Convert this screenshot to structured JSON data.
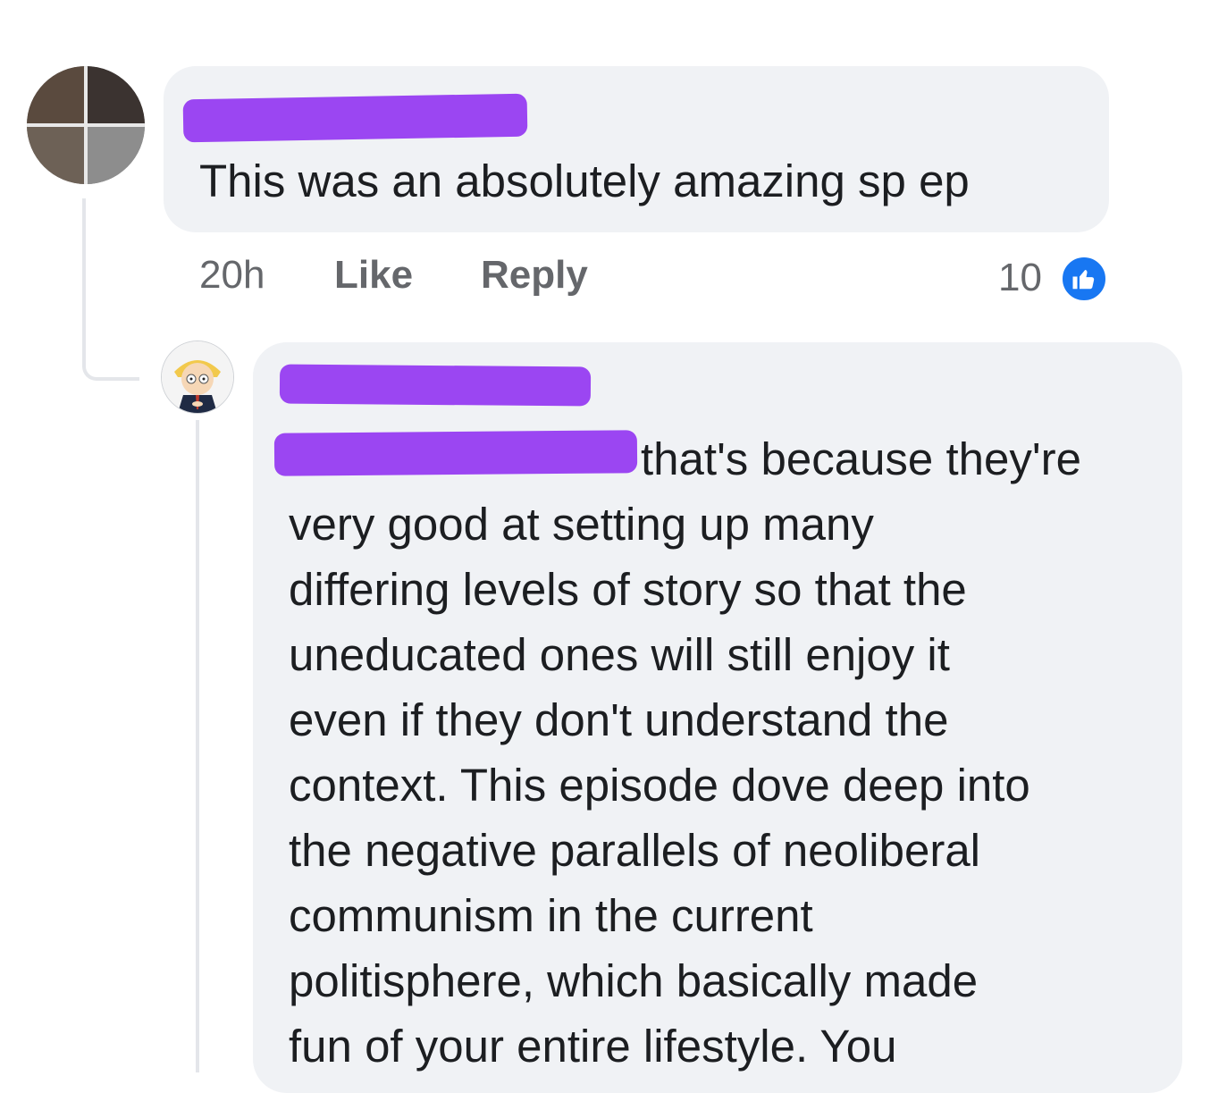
{
  "comment_1": {
    "text": "This was an absolutely amazing sp ep",
    "time": "20h",
    "like_label": "Like",
    "reply_label": "Reply",
    "reaction_count": "10",
    "reaction_icon": "thumbs-up-icon"
  },
  "comment_2": {
    "lines": [
      "that's because they're",
      "very good at setting up many",
      "differing levels of story so that the",
      "uneducated ones will still enjoy it",
      "even if they don't understand the",
      "context. This episode dove deep into",
      "the negative parallels of neoliberal",
      "communism in the current",
      "politisphere, which basically made",
      "fun of your entire lifestyle. You"
    ]
  },
  "colors": {
    "bubble_bg": "#f0f2f5",
    "redaction": "#9b46f2",
    "like_blue": "#1877f2",
    "meta_gray": "#65676b",
    "text": "#1c1e21"
  }
}
